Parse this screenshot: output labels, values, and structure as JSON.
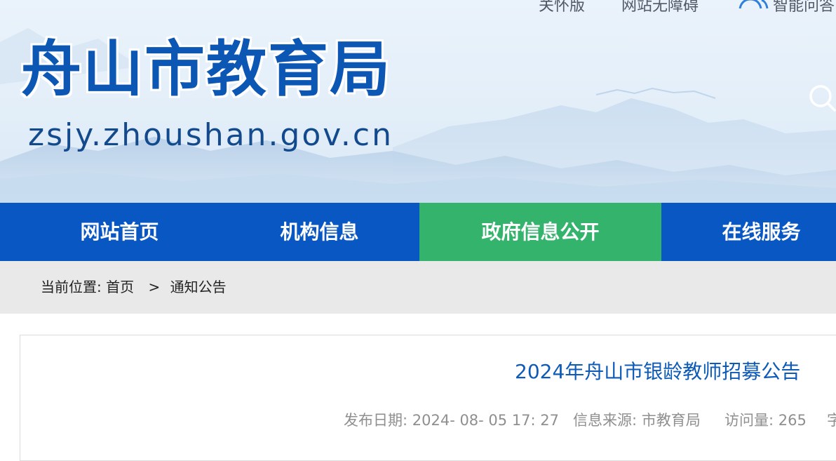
{
  "top_links": {
    "elder": "关怀版",
    "access": "网站无障碍",
    "qa": "智能问答"
  },
  "site": {
    "title": "舟山市教育局",
    "domain": "zsjy.zhoushan.gov.cn"
  },
  "nav": [
    {
      "label": "网站首页"
    },
    {
      "label": "机构信息"
    },
    {
      "label": "政府信息公开"
    },
    {
      "label": "在线服务"
    }
  ],
  "breadcrumb": {
    "prefix": "当前位置:",
    "home": "首页",
    "separator": ">",
    "current": "通知公告"
  },
  "article": {
    "title": "2024年舟山市银龄教师招募公告",
    "date_label": "发布日期: 2024- 08- 05 17: 27",
    "source_label": "信息来源: 市教育局",
    "visits_label": "访问量: 265",
    "font_label": "字"
  },
  "colors": {
    "brand_blue": "#0957c3",
    "active_green": "#33b36b",
    "title_blue": "#0d5ab8"
  },
  "icons": {
    "qa": "person-group-icon",
    "search": "search-icon"
  }
}
